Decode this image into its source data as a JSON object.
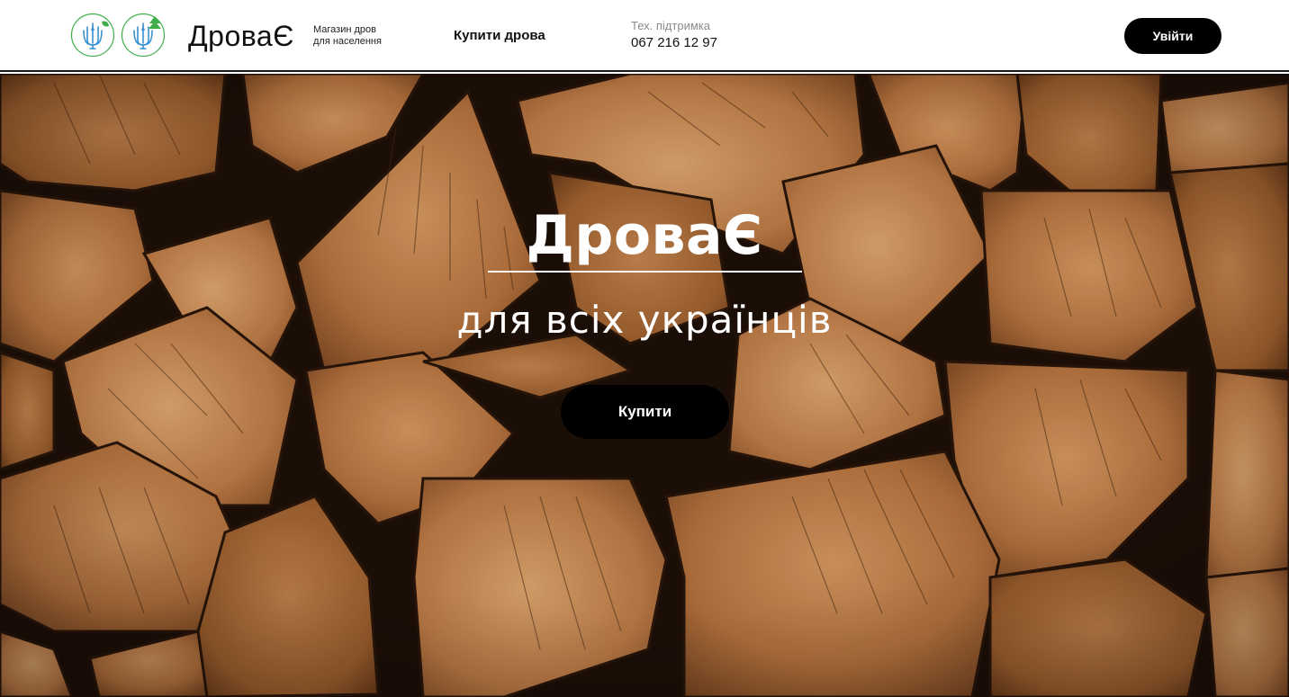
{
  "header": {
    "brand": "ДроваЄ",
    "tagline_line1": "Магазин дров",
    "tagline_line2": "для населення",
    "nav_buy": "Купити дрова",
    "support_label": "Тех. підтримка",
    "support_phone": "067 216 12 97",
    "login_label": "Увійти",
    "icons": [
      "trident-emblem-icon",
      "trident-leaf-emblem-icon"
    ],
    "accent_color": "#3fae49"
  },
  "hero": {
    "title": "ДроваЄ",
    "subtitle": "для всіх українців",
    "cta_label": "Купити",
    "background": "split-firewood-photo"
  },
  "colors": {
    "button_bg": "#000000",
    "button_text": "#ffffff",
    "hero_text": "#ffffff",
    "wood_light": "#c98a52",
    "wood_dark": "#2a160a"
  }
}
